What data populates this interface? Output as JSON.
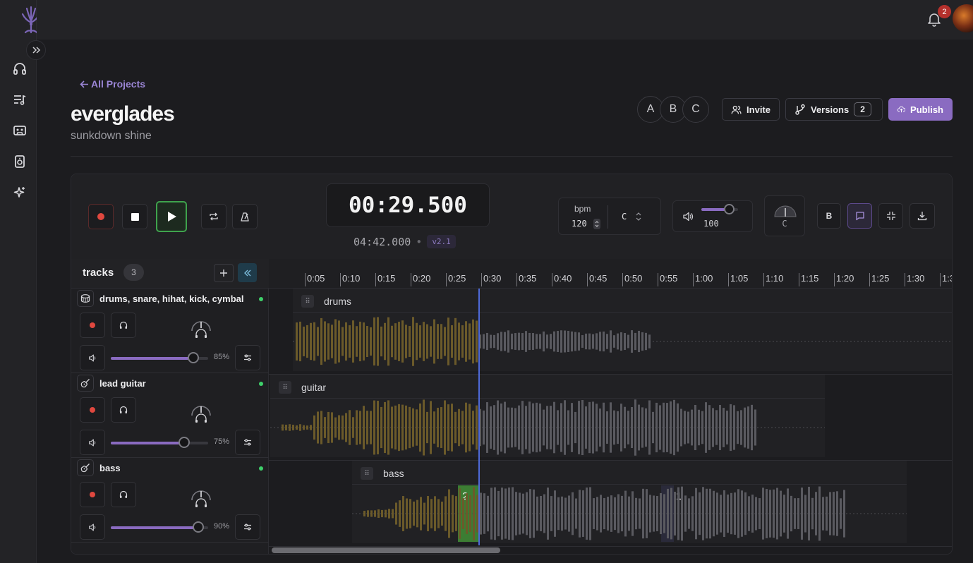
{
  "app": {
    "notifications_count": "2"
  },
  "sidebar": {
    "items": [
      {
        "icon": "headphones-icon"
      },
      {
        "icon": "playlist-icon"
      },
      {
        "icon": "cassette-icon"
      },
      {
        "icon": "speaker-icon"
      },
      {
        "icon": "sparkles-icon"
      }
    ]
  },
  "header": {
    "back_label": "All Projects",
    "title": "everglades",
    "subtitle": "sunkdown shine",
    "collaborators": [
      "A",
      "B",
      "C"
    ],
    "invite_label": "Invite",
    "versions_label": "Versions",
    "versions_count": "2",
    "publish_label": "Publish"
  },
  "transport": {
    "current_time": "00:29.500",
    "total_time": "04:42.000",
    "version": "v2.1",
    "bpm_label": "bpm",
    "bpm": "120",
    "key": "C",
    "volume": "100",
    "volume_level": 0.75,
    "tuner_note": "C",
    "b_label": "B"
  },
  "tracks_panel": {
    "title": "tracks",
    "count": "3"
  },
  "tracks": [
    {
      "name": "drums, snare, hihat, kick, cymbal",
      "volume_pct": "85%",
      "volume": 0.85,
      "icon": "drum-icon"
    },
    {
      "name": "lead guitar",
      "volume_pct": "75%",
      "volume": 0.75,
      "icon": "guitar-icon"
    },
    {
      "name": "bass",
      "volume_pct": "90%",
      "volume": 0.9,
      "icon": "guitar-icon"
    }
  ],
  "ruler": [
    "0:05",
    "0:10",
    "0:15",
    "0:20",
    "0:25",
    "0:30",
    "0:35",
    "0:40",
    "0:45",
    "0:50",
    "0:55",
    "1:00",
    "1:05",
    "1:10",
    "1:15",
    "1:20",
    "1:25",
    "1:30",
    "1:3"
  ],
  "clips": [
    {
      "label": "drums"
    },
    {
      "label": "guitar"
    },
    {
      "label": "bass"
    }
  ],
  "markers": [
    "2",
    "1"
  ],
  "colors": {
    "accent": "#8a6bc1",
    "played_wave": "#6b5a2a",
    "unplayed_wave": "#5a5a60",
    "playhead": "#4e6ad8",
    "marker_green": "#3c7d33"
  }
}
